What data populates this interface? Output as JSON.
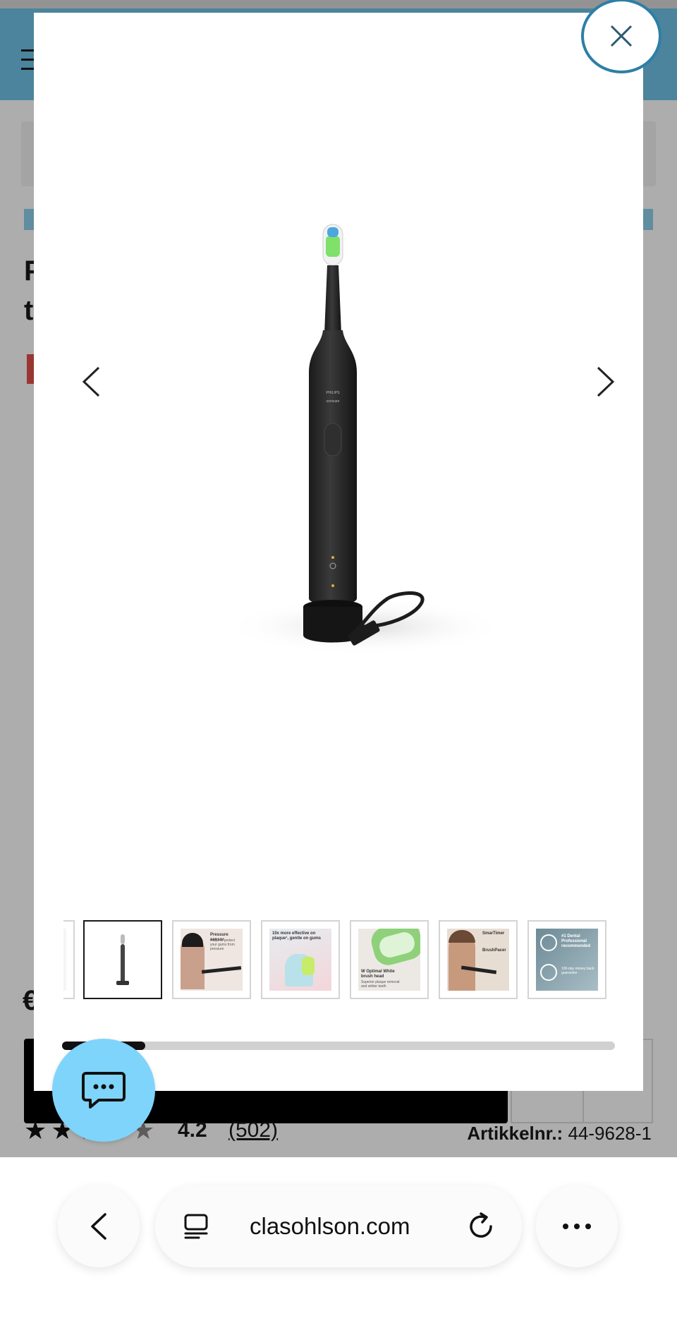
{
  "background_page": {
    "title_partial": "P\nt",
    "price_partial": "€",
    "rating": "4.2",
    "reviews": "(502)",
    "stars": [
      "★",
      "★",
      "★",
      "★",
      "★"
    ],
    "sku_label": "Artikkelnr.:",
    "sku_value": "44-9628-1"
  },
  "gallery": {
    "product_name": "PHILIPS",
    "product_series": "sonicare",
    "thumbnails": [
      {
        "caption": "",
        "sub": ""
      },
      {
        "caption": "",
        "sub": ""
      },
      {
        "caption": "Pressure sensor",
        "sub": "Helps to protect your gums from pressure"
      },
      {
        "caption": "10x more effective on plaque¹, gentle on gums",
        "sub": ""
      },
      {
        "caption": "W Optimal White brush head",
        "sub": "Superior plaque removal and whiter teeth"
      },
      {
        "caption": "SmarTimer",
        "sub": "BrushPacer"
      },
      {
        "caption": "#1 Dental Professional recommended",
        "sub": "100-day money back guarantee"
      }
    ],
    "scroll_position": 0.15
  },
  "browser": {
    "url": "clasohlson.com"
  },
  "colors": {
    "header": "#6fc3e6",
    "close_ring": "#2d7fa6",
    "chat_button": "#7fd4fb"
  },
  "icons": {
    "close": "close-icon",
    "prev": "chevron-left-icon",
    "next": "chevron-right-icon",
    "chat": "chat-bubble-icon",
    "back": "back-arrow-icon",
    "tabs": "tabs-icon",
    "reload": "reload-icon",
    "more": "more-icon"
  }
}
